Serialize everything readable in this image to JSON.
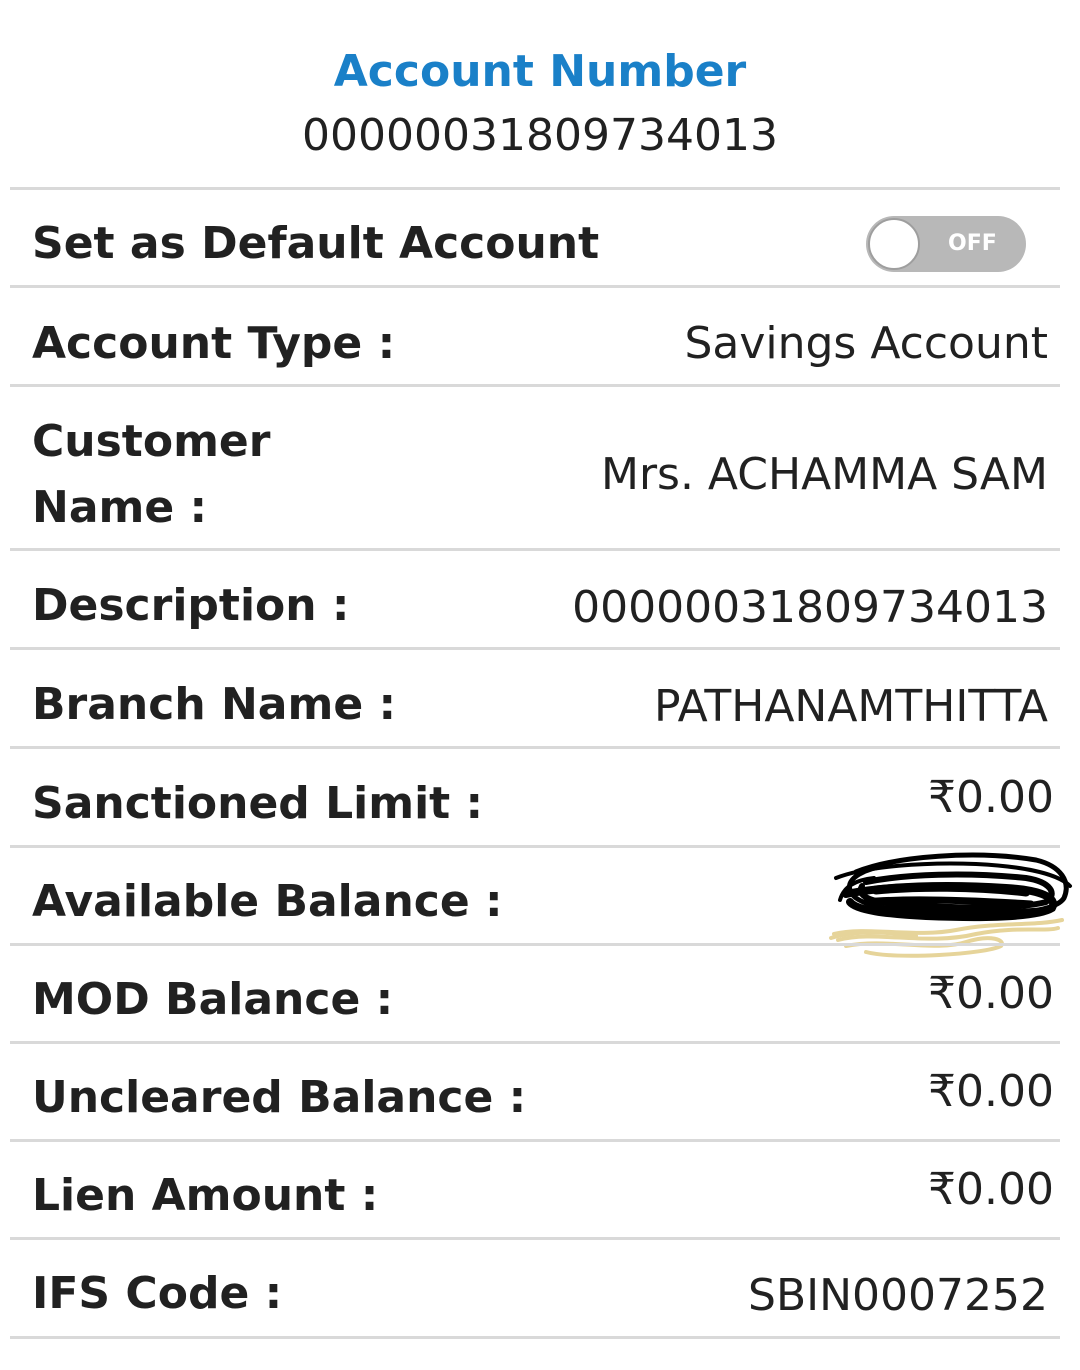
{
  "header": {
    "title": "Account Number",
    "account_number": "00000031809734013"
  },
  "default_account": {
    "label": "Set as Default Account",
    "toggle_text": "OFF",
    "toggle_state": "off"
  },
  "rows": [
    {
      "label": "Account Type :",
      "value": "Savings Account"
    },
    {
      "label_line1": "Customer",
      "label_line2": "Name :",
      "value": "Mrs. ACHAMMA  SAM"
    },
    {
      "label": "Description :",
      "value": "00000031809734013"
    },
    {
      "label": "Branch Name :",
      "value": "PATHANAMTHITTA"
    },
    {
      "label": "Sanctioned Limit :",
      "value": "₹0.00"
    },
    {
      "label": "Available Balance :",
      "value": ""
    },
    {
      "label": "MOD Balance :",
      "value": "₹0.00"
    },
    {
      "label": "Uncleared Balance :",
      "value": "₹0.00"
    },
    {
      "label": "Lien Amount :",
      "value": "₹0.00"
    },
    {
      "label": "IFS Code :",
      "value": "SBIN0007252"
    }
  ],
  "colors": {
    "accent": "#1a80c8",
    "text": "#212121",
    "divider": "#d9d9d9",
    "toggle_track": "#b8b8b8",
    "scribble_dark": "#000000",
    "scribble_light": "#e6d49a"
  }
}
